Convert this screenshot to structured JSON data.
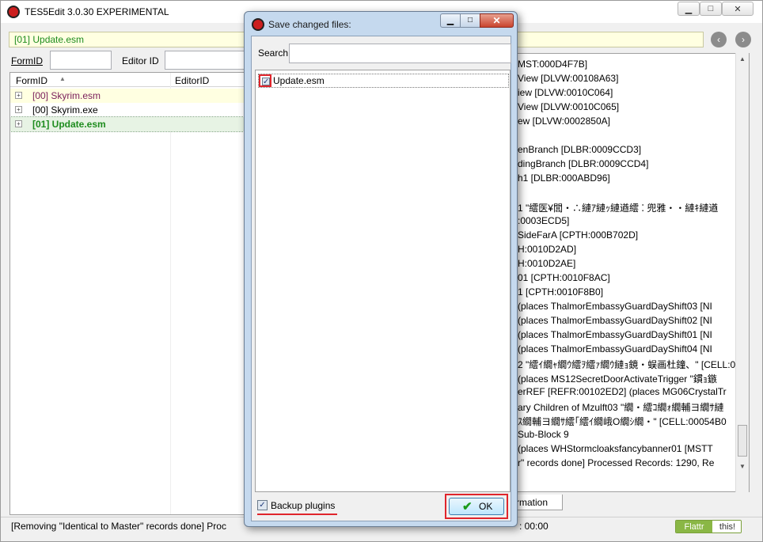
{
  "main": {
    "title": "TES5Edit 3.0.30 EXPERIMENTAL",
    "file_bar": "[01] Update.esm",
    "formid_label": "FormID",
    "editorid_label": "Editor ID",
    "tree_headers": {
      "formid": "FormID",
      "editorid": "EditorID"
    },
    "tree_rows": [
      {
        "label": "[00] Skyrim.esm",
        "color": "#7a1e5a",
        "bold": false,
        "background": "#ffffe1"
      },
      {
        "label": "[00] Skyrim.exe",
        "color": "#000000",
        "bold": false,
        "background": "#ffffff"
      },
      {
        "label": "[01] Update.esm",
        "color": "#1e8c1e",
        "bold": true,
        "background": "#e7f3e4"
      }
    ],
    "log_lines": [
      "MST:000D4F7B]",
      "View [DLVW:00108A63]",
      "iew [DLVW:0010C064]",
      "View [DLVW:0010C065]",
      "ew [DLVW:0002850A]",
      "",
      "enBranch [DLBR:0009CCD3]",
      "dingBranch [DLBR:0009CCD4]",
      "h1 [DLBR:000ABD96]",
      "",
      "1 \"繧医¥閭・∴縺ｱ縺ｯ縺遒繧 ⁚ 兜雅・・縺ｷ縺遒",
      ":0003ECD5]",
      "SideFarA [CPTH:000B702D]",
      "H:0010D2AD]",
      "H:0010D2AE]",
      "01 [CPTH:0010F8AC]",
      "1 [CPTH:0010F8B0]",
      "(places ThalmorEmbassyGuardDayShift03 [NI",
      "(places ThalmorEmbassyGuardDayShift02 [NI",
      "(places ThalmorEmbassyGuardDayShift01 [NI",
      "(places ThalmorEmbassyGuardDayShift04 [NI",
      "2 \"繧ｲ繝ｬ繝ｳ繧ｦ繧ｧ繝ｳ縺ｮ鏡・蜈画杜鐘、\" [CELL:0",
      "(places MS12SecretDoorActivateTrigger \"鏆ｮ鏃",
      "erREF [REFR:00102ED2] (places MG06CrystalTr",
      "ary Children of Mzulft03 \"繝・繧ｺ繝ｫ繝輔ヨ繝ｻ縺",
      "ｽ繝輔ヨ繝ｻ繧｢繧ｲ繝峨O繝ｼ繝・\" [CELL:00054B0",
      "Sub-Block 9",
      "(places WHStormcloaksfancybanner01 [MSTT",
      "r\" records done]  Processed Records: 1290, Re"
    ],
    "right_tab": "rmation",
    "status_text": "[Removing \"Identical to Master\" records done]  Proc",
    "status_time": ": 00:00",
    "flattr_left": "Flattr",
    "flattr_right": "this!"
  },
  "dialog": {
    "title": "Save changed files:",
    "search_label": "Search",
    "search_value": "",
    "items": [
      {
        "label": "Update.esm",
        "checked": true
      }
    ],
    "backup_label": "Backup plugins",
    "ok_label": "OK"
  },
  "colors": {
    "highlight_red": "#e0252c",
    "plugin_green": "#1e8c1e",
    "master_purple": "#7a1e5a",
    "dialog_frame": "#c5d9ee"
  }
}
